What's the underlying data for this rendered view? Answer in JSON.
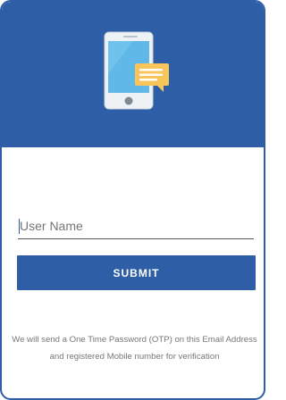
{
  "header": {
    "illustration_icon": "phone-with-message-icon"
  },
  "form": {
    "username_placeholder": "User Name",
    "username_value": "",
    "submit_label": "SUBMIT",
    "info_text": "We will send a One Time Password (OTP) on this Email Address and registered Mobile number for verification"
  },
  "colors": {
    "primary": "#2e5ea6",
    "phone_screen": "#5fb8e8",
    "message_bubble": "#f7c55a",
    "phone_body": "#eef2f5"
  }
}
